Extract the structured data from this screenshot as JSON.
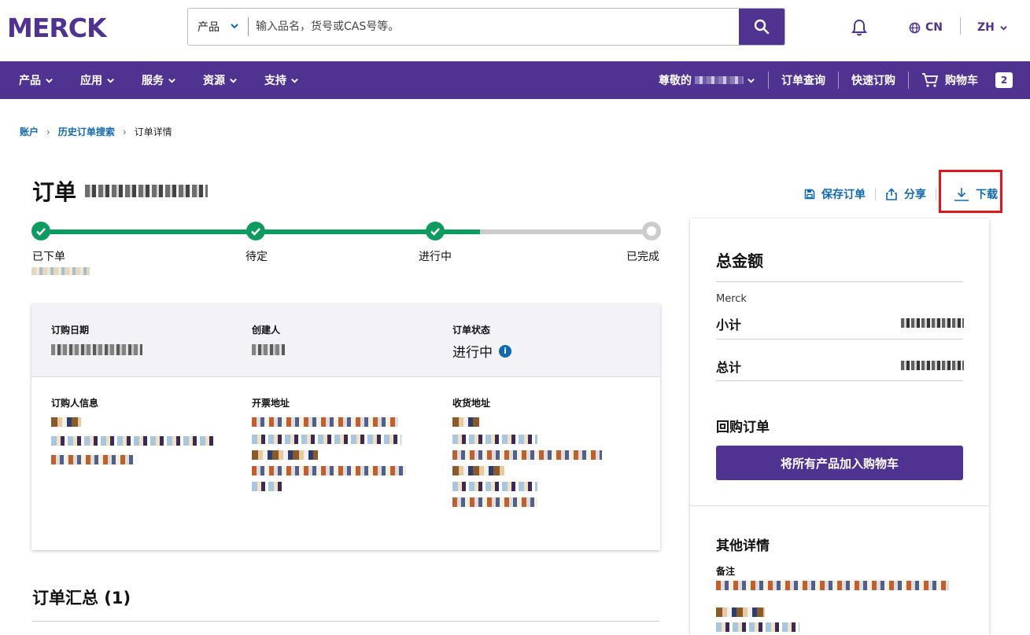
{
  "header": {
    "search": {
      "category": "产品",
      "placeholder": "输入品名，货号或CAS号等。"
    },
    "region": "CN",
    "language": "ZH"
  },
  "nav": {
    "items": [
      "产品",
      "应用",
      "服务",
      "资源",
      "支持"
    ],
    "greeting": "尊敬的",
    "order_lookup": "订单查询",
    "quick_order": "快速订购",
    "cart_label": "购物车",
    "cart_count": "2"
  },
  "breadcrumb": {
    "items": [
      "账户",
      "历史订单搜索"
    ],
    "current": "订单详情"
  },
  "order": {
    "title": "订单",
    "actions": {
      "save": "保存订单",
      "share": "分享",
      "download": "下载"
    },
    "steps": [
      {
        "label": "已下单",
        "done": true
      },
      {
        "label": "待定",
        "done": true
      },
      {
        "label": "进行中",
        "done": true
      },
      {
        "label": "已完成",
        "done": false
      }
    ],
    "info": {
      "order_date_label": "订购日期",
      "creator_label": "创建人",
      "status_label": "订单状态",
      "status_value": "进行中",
      "buyer_label": "订购人信息",
      "billing_label": "开票地址",
      "shipping_label": "收货地址"
    },
    "summary_title": "订单汇总 (1)"
  },
  "totals": {
    "title": "总金额",
    "vendor": "Merck",
    "subtotal_label": "小计",
    "total_label": "总计",
    "reorder_title": "回购订单",
    "reorder_button": "将所有产品加入购物车",
    "other_title": "其他详情",
    "note_label": "备注"
  },
  "colors": {
    "brand": "#503291",
    "link": "#0f69af",
    "progress": "#0f9a60",
    "highlight": "#e0161f"
  }
}
